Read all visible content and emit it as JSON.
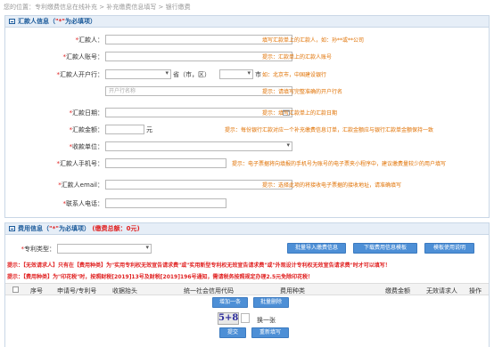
{
  "breadcrumb": "您的位置：专利缴费信息在线补充 > 补充缴费信息填写 > 银行缴费",
  "remitter": {
    "title": "汇款人信息",
    "title_note_open": "（",
    "title_note_star": "\"*\"",
    "title_note_rest": "为必填项）",
    "fields": {
      "name_label": "汇款人：",
      "name_hint": "填写汇款单上的汇款人，如：孙**或**公司",
      "account_label": "汇款人账号：",
      "account_hint": "提示：汇款单上的汇款人账号",
      "bank_label": "汇款人开户行：",
      "province_suffix": "省（市，区）",
      "city_suffix": "市",
      "bank_hint": "如：北京市，中国建设银行",
      "bank_name_placeholder": "开户行名称",
      "bank_name_hint": "提示：请填写完整准确的开户行名",
      "date_label": "汇款日期：",
      "date_hint": "提示：填写汇款单上的汇款日期",
      "amount_label": "汇款金额：",
      "amount_unit": "元",
      "amount_hint": "提示：每份银行汇款对应一个补充缴费信息订单，汇款金额应与银行汇款单金额保持一致",
      "payee_label": "收款单位：",
      "phone_label": "汇款人手机号：",
      "phone_hint": "提示：电子票据将向填报的手机号为账号的电子票夹小程序中，建议缴费量较少的用户填写",
      "email_label": "汇款人email：",
      "email_hint": "提示：选择此项的将接收电子票据的接收地址，请准确填写",
      "contact_label": "联系人电话："
    }
  },
  "fees": {
    "title": "费用信息",
    "title_note_open": "（",
    "title_note_star": "\"*\"",
    "title_note_rest": "为必填项）",
    "total": "(缴费总额：0元)",
    "patent_type_label": "专利类型：",
    "buttons": {
      "batch_import": "批量导入缴费信息",
      "download_template": "下载费用信息模板",
      "template_help": "模板使用说明"
    },
    "warning_1": "提示：【无效请求人】只有在【费用种类】为\"实用专利权无效宣告请求费\"或\"实用新型专利权无效宣告请求费\"或\"外观设计专利权无效宣告请求费\"时才可以填写！",
    "warning_2": "提示：【费用种类】为\"印花税\"时，按照财税[2019]13号及财税[2019]196号通知，需请税务按照规定办理2.5元免除印花税！",
    "columns": [
      "序号",
      "申请号/专利号",
      "收据抬头",
      "统一社会信用代码",
      "费用种类",
      "缴费金额",
      "无效请求人",
      "操作"
    ],
    "add_row": "增加一条",
    "batch_delete": "批量删除",
    "captcha": "5+8",
    "captcha_refresh": "换一张",
    "submit": "提交",
    "reset": "重新填写"
  },
  "colors": {
    "accent": "#4d8fd6",
    "header_bg": "#e6eef7",
    "warning": "#e02020",
    "hint": "#e07000"
  }
}
